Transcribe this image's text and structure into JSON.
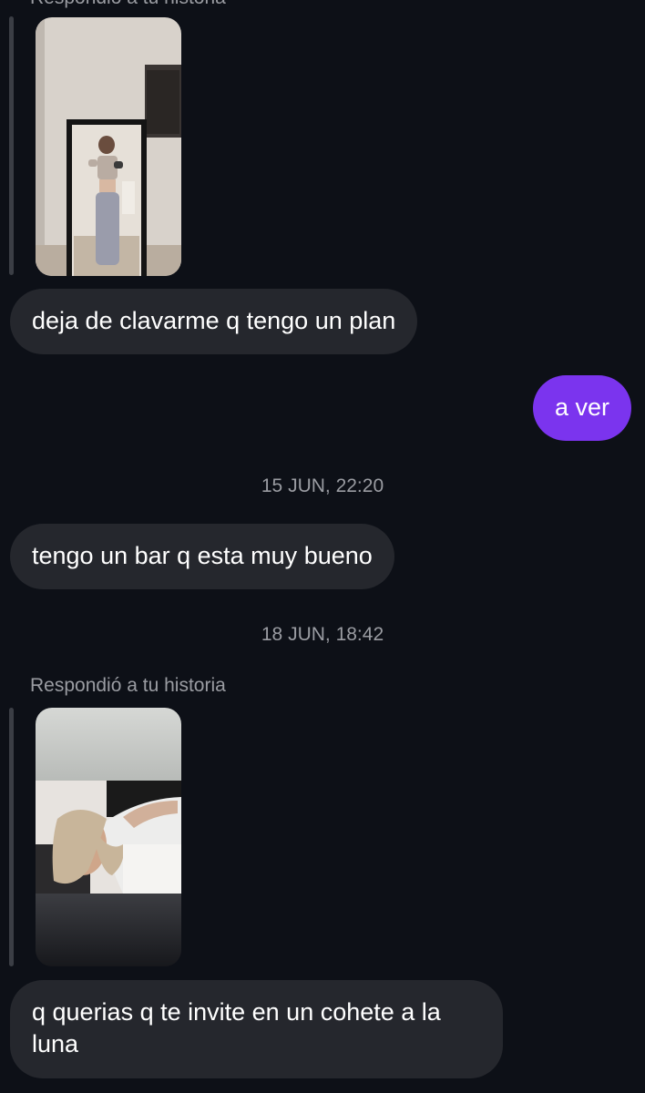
{
  "conversation": {
    "top_reply_label": "Respondió a tu historia",
    "messages": [
      {
        "text": "deja de clavarme q tengo un plan"
      },
      {
        "text": "a ver"
      },
      {
        "text": "tengo un bar q esta muy bueno"
      },
      {
        "text": "q querias q te invite en un cohete a la luna"
      }
    ],
    "timestamps": [
      "15 JUN, 22:20",
      "18 JUN, 18:42"
    ],
    "reply_label": "Respondió a tu historia"
  },
  "colors": {
    "background": "#0d1017",
    "incoming_bubble": "#25272d",
    "outgoing_bubble": "#7b34ee",
    "meta_text": "#9a9ca2"
  }
}
